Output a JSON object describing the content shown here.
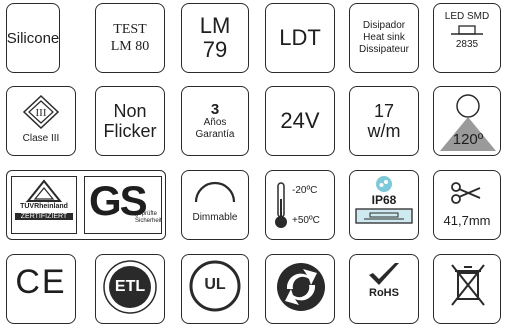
{
  "row1": {
    "silicone": "Silicone",
    "test": "TEST",
    "lm80": "LM 80",
    "lm": "LM",
    "lm_num": "79",
    "ldt": "LDT",
    "disipador": "Disipador",
    "heatsink": "Heat sink",
    "dissipateur": "Dissipateur",
    "led_smd": "LED SMD",
    "led_code": "2835"
  },
  "row2": {
    "clase": "Clase III",
    "roman": "III",
    "non": "Non",
    "flicker": "Flicker",
    "years": "3",
    "anos": "Años",
    "garantia": "Garantía",
    "voltage": "24V",
    "leds_num": "17",
    "leds_unit": "w/m",
    "angle": "120º"
  },
  "row3": {
    "tuv1": "TÜVRheinland",
    "tuv2": "ZERTIFIZIERT",
    "gs": "GS",
    "gs_sub1": "geprüfte",
    "gs_sub2": "Sicherheit",
    "dimmable": "Dimmable",
    "temp_high": "-20ºC",
    "temp_low": "+50ºC",
    "ip": "IP68",
    "cut": "41,7mm"
  },
  "row4": {
    "ce": "CE",
    "etl": "ETL",
    "etl_sub": "LISTED",
    "ul": "UL",
    "rohs": "RoHS"
  },
  "colors": {
    "border": "#2a2a2a",
    "accent_cyan": "#7ec9d9",
    "angle_grey": "#9a9a9a"
  }
}
